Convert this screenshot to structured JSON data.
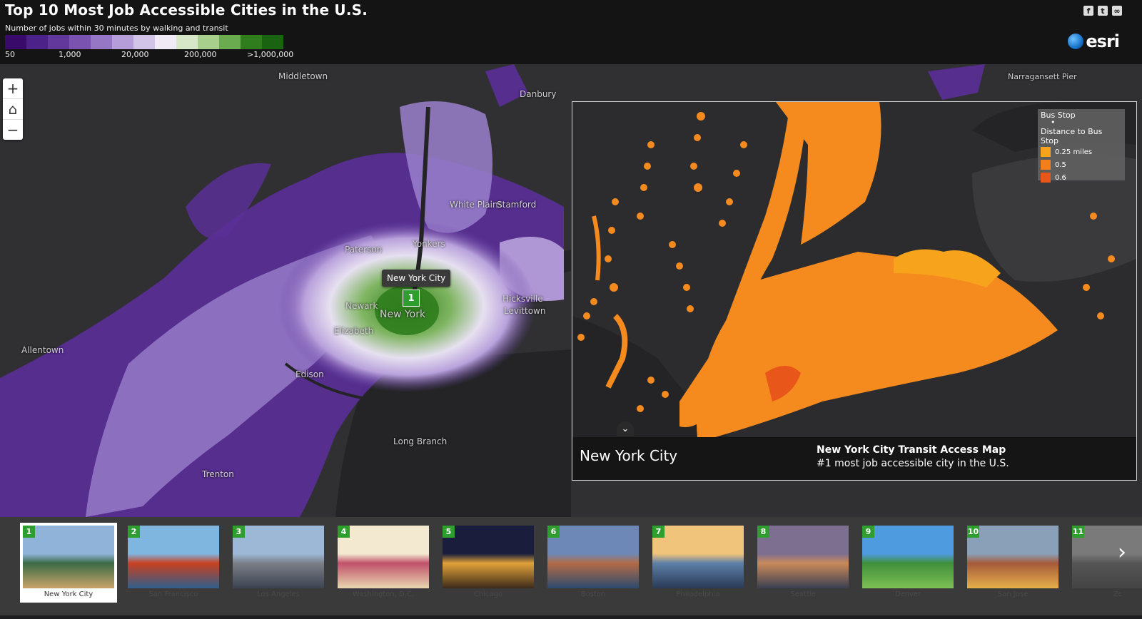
{
  "header": {
    "title": "Top 10 Most Job Accessible Cities in the U.S.",
    "legend_caption": "Number of jobs within 30 minutes by walking and transit",
    "legend_colors": [
      "#3a0a6b",
      "#4d2288",
      "#62389c",
      "#7a52b0",
      "#9677c6",
      "#b49dd8",
      "#d2c4e8",
      "#efeaf5",
      "#d7e8c8",
      "#a9cf8c",
      "#6bab4f",
      "#2f7d1d",
      "#1a6311"
    ],
    "legend_labels": [
      "50",
      "1,000",
      "20,000",
      "200,000",
      ">1,000,000"
    ],
    "brand": "esri"
  },
  "share_icons": [
    "facebook-icon",
    "twitter-icon",
    "link-icon"
  ],
  "map": {
    "places": [
      "Middletown",
      "Danbury",
      "Paterson",
      "Yonkers",
      "White Plains",
      "Stamford",
      "Newark",
      "New York",
      "Hicksville",
      "Levittown",
      "Elizabeth",
      "Allentown",
      "Edison",
      "Long Branch",
      "Trenton",
      "Narragansett Pier"
    ],
    "callout": "New York City",
    "marker": "1"
  },
  "inset": {
    "legend_title": "Bus  Stop",
    "legend_distance": "Distance  to  Bus  Stop",
    "legend_items": [
      {
        "label": "0.25  miles",
        "color": "#f7a41c"
      },
      {
        "label": "0.5",
        "color": "#f47f1a"
      },
      {
        "label": "0.6",
        "color": "#e8561a"
      }
    ],
    "city": "New York City",
    "map_title": "New York City Transit Access Map",
    "map_subtitle": "#1 most job accessible city in the U.S."
  },
  "cities": [
    {
      "num": "1",
      "name": "New York City"
    },
    {
      "num": "2",
      "name": "San Francisco"
    },
    {
      "num": "3",
      "name": "Los Angeles"
    },
    {
      "num": "4",
      "name": "Washington, D.C."
    },
    {
      "num": "5",
      "name": "Chicago"
    },
    {
      "num": "6",
      "name": "Boston"
    },
    {
      "num": "7",
      "name": "Philadelphia"
    },
    {
      "num": "8",
      "name": "Seattle"
    },
    {
      "num": "9",
      "name": "Denver"
    },
    {
      "num": "10",
      "name": "San Jose"
    },
    {
      "num": "11",
      "name": "Zc"
    }
  ]
}
